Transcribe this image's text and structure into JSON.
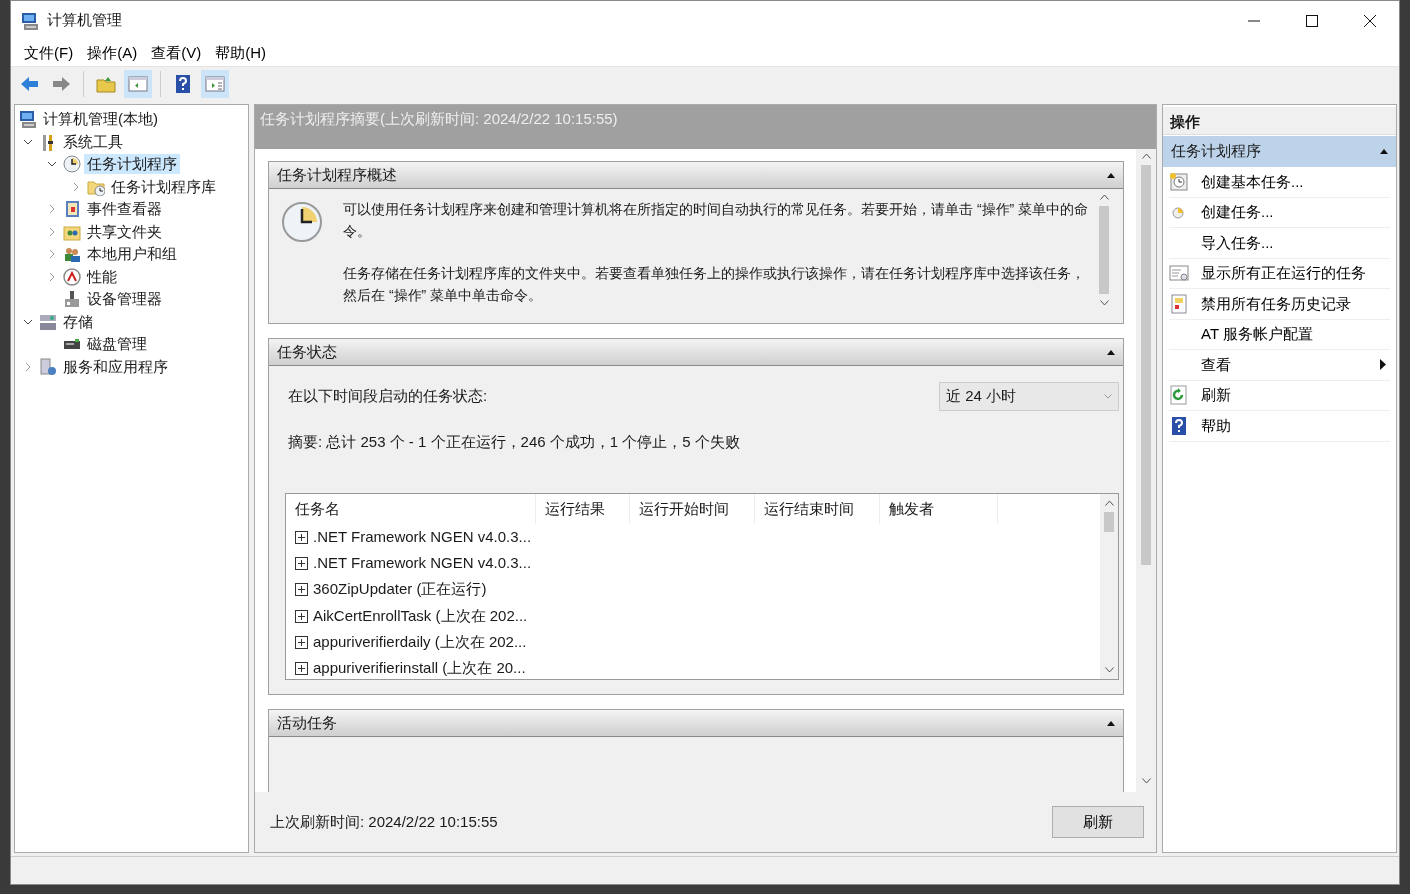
{
  "window": {
    "title": "计算机管理"
  },
  "menu": [
    "文件(F)",
    "操作(A)",
    "查看(V)",
    "帮助(H)"
  ],
  "toolbar": [
    {
      "pressed": false
    },
    {
      "pressed": false
    },
    {
      "pressed": false
    },
    {
      "pressed": true
    },
    {
      "pressed": false
    },
    {
      "pressed": true
    }
  ],
  "tree": [
    {
      "label": "计算机管理(本地)",
      "selected": false,
      "children": [
        {
          "label": "系统工具",
          "expanded": true,
          "selected": false,
          "children": [
            {
              "label": "任务计划程序",
              "expanded": true,
              "selected": true,
              "children": [
                {
                  "label": "任务计划程序库",
                  "expanded": false,
                  "selected": false
                }
              ]
            },
            {
              "label": "事件查看器",
              "expanded": false,
              "selected": false
            },
            {
              "label": "共享文件夹",
              "expanded": false,
              "selected": false
            },
            {
              "label": "本地用户和组",
              "expanded": false,
              "selected": false
            },
            {
              "label": "性能",
              "expanded": false,
              "selected": false
            },
            {
              "label": "设备管理器",
              "selected": false
            }
          ]
        },
        {
          "label": "存储",
          "expanded": true,
          "selected": false,
          "children": [
            {
              "label": "磁盘管理",
              "selected": false
            }
          ]
        },
        {
          "label": "服务和应用程序",
          "expanded": false,
          "selected": false
        }
      ]
    }
  ],
  "center": {
    "title": "任务计划程序摘要(上次刷新时间: 2024/2/22 10:15:55)",
    "overview": {
      "title": "任务计划程序概述",
      "paragraphs": [
        "可以使用任务计划程序来创建和管理计算机将在所指定的时间自动执行的常见任务。若要开始，请单击 “操作” 菜单中的命令。",
        "任务存储在任务计划程序库的文件夹中。若要查看单独任务上的操作或执行该操作，请在任务计划程序库中选择该任务，然后在 “操作” 菜单中单击命令。"
      ]
    },
    "status": {
      "title": "任务状态",
      "period_label": "在以下时间段启动的任务状态:",
      "period": "近 24 小时",
      "summary": "摘要: 总计 253 个 - 1 个正在运行，246 个成功，1 个停止，5 个失败",
      "columns": [
        "任务名",
        "运行结果",
        "运行开始时间",
        "运行结束时间",
        "触发者"
      ],
      "rows": [
        ".NET Framework NGEN v4.0.3...",
        ".NET Framework NGEN v4.0.3...",
        "360ZipUpdater (正在运行)",
        "AikCertEnrollTask (上次在 202...",
        "appuriverifierdaily (上次在 202...",
        "appuriverifierinstall (上次在 20..."
      ]
    },
    "active": {
      "title": "活动任务"
    },
    "last_refresh": "上次刷新时间: 2024/2/22 10:15:55",
    "refresh_button": "刷新"
  },
  "actions": {
    "title": "操作",
    "group": "任务计划程序",
    "items": [
      {
        "label": "创建基本任务...",
        "kind": "item"
      },
      {
        "label": "创建任务...",
        "kind": "item"
      },
      {
        "label": "导入任务...",
        "kind": "item"
      },
      {
        "label": "显示所有正在运行的任务",
        "kind": "item"
      },
      {
        "label": "禁用所有任务历史记录",
        "kind": "item"
      },
      {
        "label": "AT 服务帐户配置",
        "kind": "item"
      },
      {
        "label": "查看",
        "kind": "submenu"
      },
      {
        "label": "刷新",
        "kind": "item"
      },
      {
        "label": "帮助",
        "kind": "item"
      }
    ]
  }
}
